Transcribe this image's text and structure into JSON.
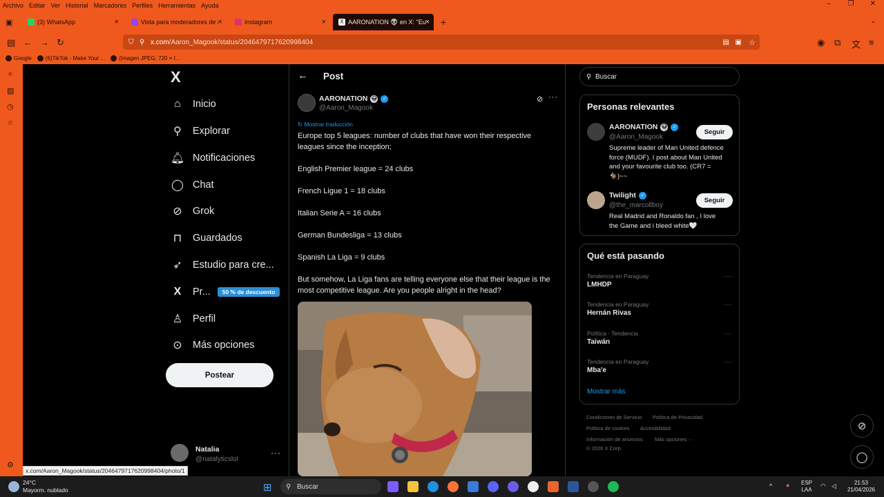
{
  "menubar": {
    "items": [
      "Archivo",
      "Editar",
      "Ver",
      "Historial",
      "Marcadores",
      "Perfiles",
      "Herramientas",
      "Ayuda"
    ]
  },
  "tabs": [
    {
      "label": "(3) WhatsApp",
      "color": "#25d366"
    },
    {
      "label": "Vista para moderadores de nat",
      "color": "#9146ff"
    },
    {
      "label": "Instagram",
      "color": "#e1306c"
    },
    {
      "label": "AARONATION 👽 en X: \"Europ",
      "color": "#ffffff"
    }
  ],
  "url": {
    "host": "x.com",
    "path": "/Aaron_Magook/status/2046479717620998404"
  },
  "bookmarks": [
    "Google",
    "(6)TikTok - Make Your ...",
    "(Imagen JPEG, 720 × I..."
  ],
  "nav": {
    "logo": "X",
    "items": [
      {
        "label": "Inicio",
        "icon": "home-icon"
      },
      {
        "label": "Explorar",
        "icon": "search-icon"
      },
      {
        "label": "Notificaciones",
        "icon": "bell-icon"
      },
      {
        "label": "Chat",
        "icon": "chat-icon"
      },
      {
        "label": "Grok",
        "icon": "grok-icon"
      },
      {
        "label": "Guardados",
        "icon": "bookmark-icon"
      },
      {
        "label": "Estudio para cre...",
        "icon": "rocket-icon"
      },
      {
        "label": "Pr...",
        "icon": "x-premium-icon"
      },
      {
        "label": "Perfil",
        "icon": "person-icon"
      },
      {
        "label": "Más opciones",
        "icon": "more-circle-icon"
      }
    ],
    "premium_badge": "50 % de descuento",
    "post_button": "Postear",
    "user": {
      "name": "Natalia",
      "handle": "@natalyticslol"
    }
  },
  "post": {
    "header": "Post",
    "author": "AARONATION",
    "handle": "@Aaron_Magook",
    "show_translation": "Mostrar traducción",
    "paragraphs": [
      "Europe top 5 leagues: number of clubs that have won their respective leagues since the inception;",
      "English Premier league = 24 clubs",
      "French Ligue 1 = 18 clubs",
      "Italian Serie A = 16 clubs",
      "German Bundesliga = 13 clubs",
      "Spanish La Liga = 9 clubs",
      "But somehow, La Liga fans are telling everyone else that their league is the most competitive league. Are you people alright in the head?"
    ]
  },
  "right": {
    "search_placeholder": "Buscar",
    "relevant_title": "Personas relevantes",
    "people": [
      {
        "name": "AARONATION",
        "handle": "@Aaron_Magook",
        "bio": "Supreme leader of Man United defence force (MUDF). I post about Man United and your favourite club too. (CR7 =🐐)~~",
        "button": "Seguir"
      },
      {
        "name": "Twilight",
        "handle": "@the_marcollboy",
        "bio": "Real Madrid and Ronaldo fan , I love the Game and i bleed white🤍",
        "button": "Seguir"
      }
    ],
    "trends_title": "Qué está pasando",
    "trends": [
      {
        "context": "Tendencia en Paraguay",
        "name": "LMHDP"
      },
      {
        "context": "Tendencia en Paraguay",
        "name": "Hernán Rivas"
      },
      {
        "context": "Política · Tendencia",
        "name": "Taiwán"
      },
      {
        "context": "Tendencia en Paraguay",
        "name": "Mba'e"
      }
    ],
    "show_more": "Mostrar más",
    "footer": [
      "Condiciones de Servicio",
      "Política de Privacidad",
      "Política de cookies",
      "Accesibilidad",
      "Información de anuncios",
      "Más opciones ···",
      "© 2026 X Corp."
    ]
  },
  "status_url": "x.com/Aaron_Magook/status/2046479717620998404/photo/1",
  "taskbar": {
    "temp": "24°C",
    "weather": "Mayorm. nublado",
    "search": "Buscar",
    "lang": "ESP",
    "lang2": "LAA",
    "time": "21:53",
    "date": "21/04/2026"
  },
  "colors": {
    "browser_accent": "#f0591e",
    "link": "#1d9bf0",
    "background": "#000000"
  }
}
